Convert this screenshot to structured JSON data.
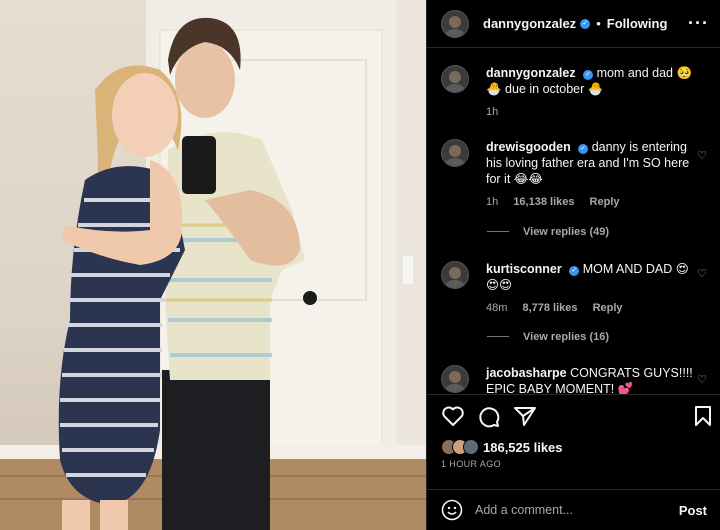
{
  "post": {
    "username": "dannygonzalez",
    "follow_status": "Following",
    "more_icon": "more-icon"
  },
  "caption": {
    "username": "dannygonzalez",
    "text": "mom and dad 🥺 🐣 due in october 🐣",
    "time": "1h"
  },
  "comments": [
    {
      "username": "drewisgooden",
      "text": "danny is entering his loving father era and I'm SO here for it 😂😂",
      "time": "1h",
      "likes": "16,138 likes",
      "reply": "Reply",
      "view_replies": "View replies (49)"
    },
    {
      "username": "kurtisconner",
      "text": "MOM AND DAD 😍 😍😍",
      "time": "48m",
      "likes": "8,778 likes",
      "reply": "Reply",
      "view_replies": "View replies (16)"
    },
    {
      "username": "jacobasharpe",
      "text": "CONGRATS GUYS!!!! EPIC BABY MOMENT! 💕"
    }
  ],
  "actions": {
    "likes": "186,525 likes",
    "time": "1 HOUR AGO"
  },
  "add_comment": {
    "placeholder": "Add a comment...",
    "post_label": "Post"
  },
  "colors": {
    "background": "#000000",
    "text": "#f5f5f5",
    "muted": "#a8a8a8",
    "verified": "#3897f0",
    "divider": "#262626"
  }
}
